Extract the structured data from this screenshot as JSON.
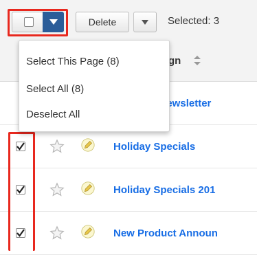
{
  "toolbar": {
    "delete_label": "Delete",
    "selected_text": "Selected: 3"
  },
  "header": {
    "column_label": "gn"
  },
  "dropdown": {
    "items": [
      {
        "label": "Select This Page (8)"
      },
      {
        "label": "Select All (8)"
      },
      {
        "label": "Deselect All"
      }
    ]
  },
  "rows": [
    {
      "name": "y Newsletter",
      "checked": false
    },
    {
      "name": "Holiday Specials",
      "checked": true
    },
    {
      "name": "Holiday Specials 201",
      "checked": true
    },
    {
      "name": "New Product Announ",
      "checked": true
    }
  ],
  "colors": {
    "highlight": "#e8281e",
    "link": "#176de5",
    "dropdown_toggle": "#2b5d99"
  },
  "icons": [
    "checkbox-icon",
    "caret-down-icon",
    "sort-icon",
    "star-icon",
    "pencil-icon",
    "checkmark-icon"
  ]
}
